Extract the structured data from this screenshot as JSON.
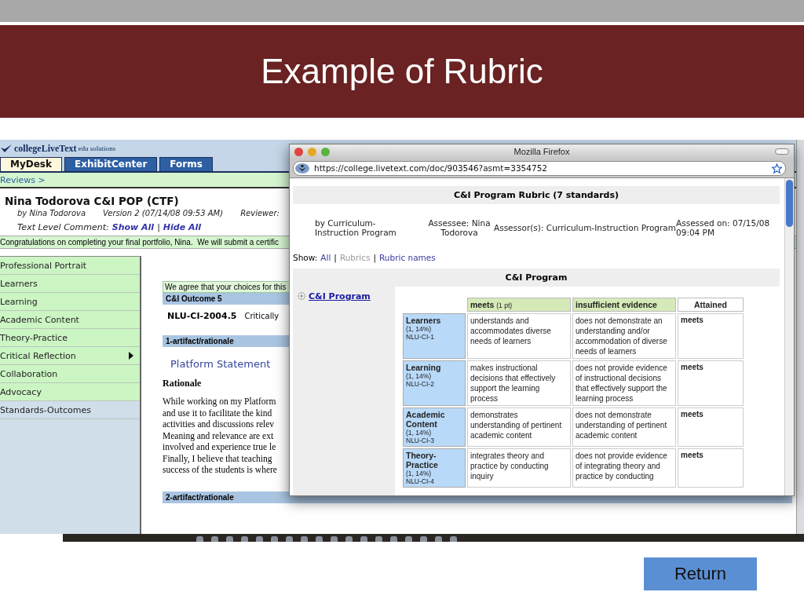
{
  "slide": {
    "title": "Example of Rubric",
    "return_button": "Return"
  },
  "app": {
    "logo": {
      "name": "collegeLiveText",
      "tagline": "edu solutions"
    },
    "tabs": [
      {
        "label": "MyDesk",
        "selected": true
      },
      {
        "label": "ExhibitCenter",
        "selected": false
      },
      {
        "label": "Forms",
        "selected": false
      }
    ],
    "breadcrumb": "Reviews >",
    "doc_title": "Nina Todorova C&I POP (CTF)",
    "byline": "by Nina Todorova",
    "version": "Version 2 (07/14/08 09:53 AM)",
    "reviewer": "Reviewer:",
    "comment_label": "Text Level Comment:",
    "comment_links": [
      "Show All",
      "Hide All"
    ],
    "separator": "|",
    "message": "Congratulations on completing your final portfolio, Nina.  We will submit a certific",
    "sidebar": [
      {
        "label": "Professional Portrait",
        "kind": "section",
        "submenu": false
      },
      {
        "label": "Learners",
        "kind": "section",
        "submenu": false
      },
      {
        "label": "Learning",
        "kind": "section",
        "submenu": false
      },
      {
        "label": "Academic Content",
        "kind": "section",
        "submenu": false
      },
      {
        "label": "Theory-Practice",
        "kind": "section",
        "submenu": false
      },
      {
        "label": "Critical Reflection",
        "kind": "section",
        "submenu": true
      },
      {
        "label": "Collaboration",
        "kind": "section",
        "submenu": false
      },
      {
        "label": "Advocacy",
        "kind": "section",
        "submenu": false
      },
      {
        "label": "Standards-Outcomes",
        "kind": "standards",
        "submenu": false
      }
    ],
    "content": [
      {
        "kind": "note",
        "text": "We agree that your choices for this"
      },
      {
        "kind": "bar",
        "text": "C&I Outcome 5"
      },
      {
        "kind": "standard",
        "code": "NLU-CI-2004.5",
        "text": "Critically"
      },
      {
        "kind": "bar",
        "text": "1-artifact/rationale"
      },
      {
        "kind": "heading",
        "text": "Platform Statement"
      },
      {
        "kind": "subheading",
        "text": "Rationale"
      },
      {
        "kind": "paragraph",
        "lines": [
          "While working on my Platform",
          "and use it to facilitate the kind",
          "activities and discussions relev",
          "Meaning and relevance are ext",
          "involved and experience true le",
          "Finally, I believe that teaching",
          "success of the students is where"
        ]
      },
      {
        "kind": "wide_bar",
        "text": "2-artifact/rationale"
      }
    ]
  },
  "browser": {
    "title": "Mozilla Firefox",
    "url": "https://college.livetext.com/doc/903546?asmt=3354752",
    "rubric_title": "C&I Program Rubric (7 standards)",
    "info": [
      "by Curriculum-Instruction Program",
      "Assessee: Nina Todorova",
      "Assessor(s): Curriculum-Instruction Program",
      "Assessed on: 07/15/08 09:04 PM"
    ],
    "show": {
      "label": "Show:",
      "separator": "|",
      "options": [
        {
          "label": "All",
          "selected": false
        },
        {
          "label": "Rubrics",
          "selected": true
        },
        {
          "label": "Rubric names",
          "selected": false
        }
      ]
    },
    "program_bar": "C&I Program",
    "tree_link": "C&I Program",
    "columns": [
      {
        "label": "meets",
        "note": "(1 pt)",
        "kind": "level"
      },
      {
        "label": "insufficient evidence",
        "kind": "level"
      },
      {
        "label": "Attained",
        "kind": "result"
      }
    ],
    "rows": [
      {
        "name": "Learners",
        "weight": "(1, 14%)",
        "code": "NLU-CI-1",
        "cells": [
          "understands and accommodates diverse needs of learners",
          "does not demonstrate an understanding and/or accommodation of diverse needs of learners"
        ],
        "attained": "meets"
      },
      {
        "name": "Learning",
        "weight": "(1, 14%)",
        "code": "NLU-CI-2",
        "cells": [
          "makes instructional decisions that effectively support the learning process",
          "does not provide evidence of instructional decisions that effectively support the learning process"
        ],
        "attained": "meets"
      },
      {
        "name": "Academic Content",
        "weight": "(1, 14%)",
        "code": "NLU-CI-3",
        "cells": [
          "demonstrates understanding of pertinent academic content",
          "does not demonstrate understanding of pertinent academic content"
        ],
        "attained": "meets"
      },
      {
        "name": "Theory-Practice",
        "weight": "(1, 14%)",
        "code": "NLU-CI-4",
        "cells": [
          "integrates theory and practice by conducting inquiry",
          "does not provide evidence of integrating theory and practice by conducting"
        ],
        "attained": "meets"
      }
    ]
  }
}
